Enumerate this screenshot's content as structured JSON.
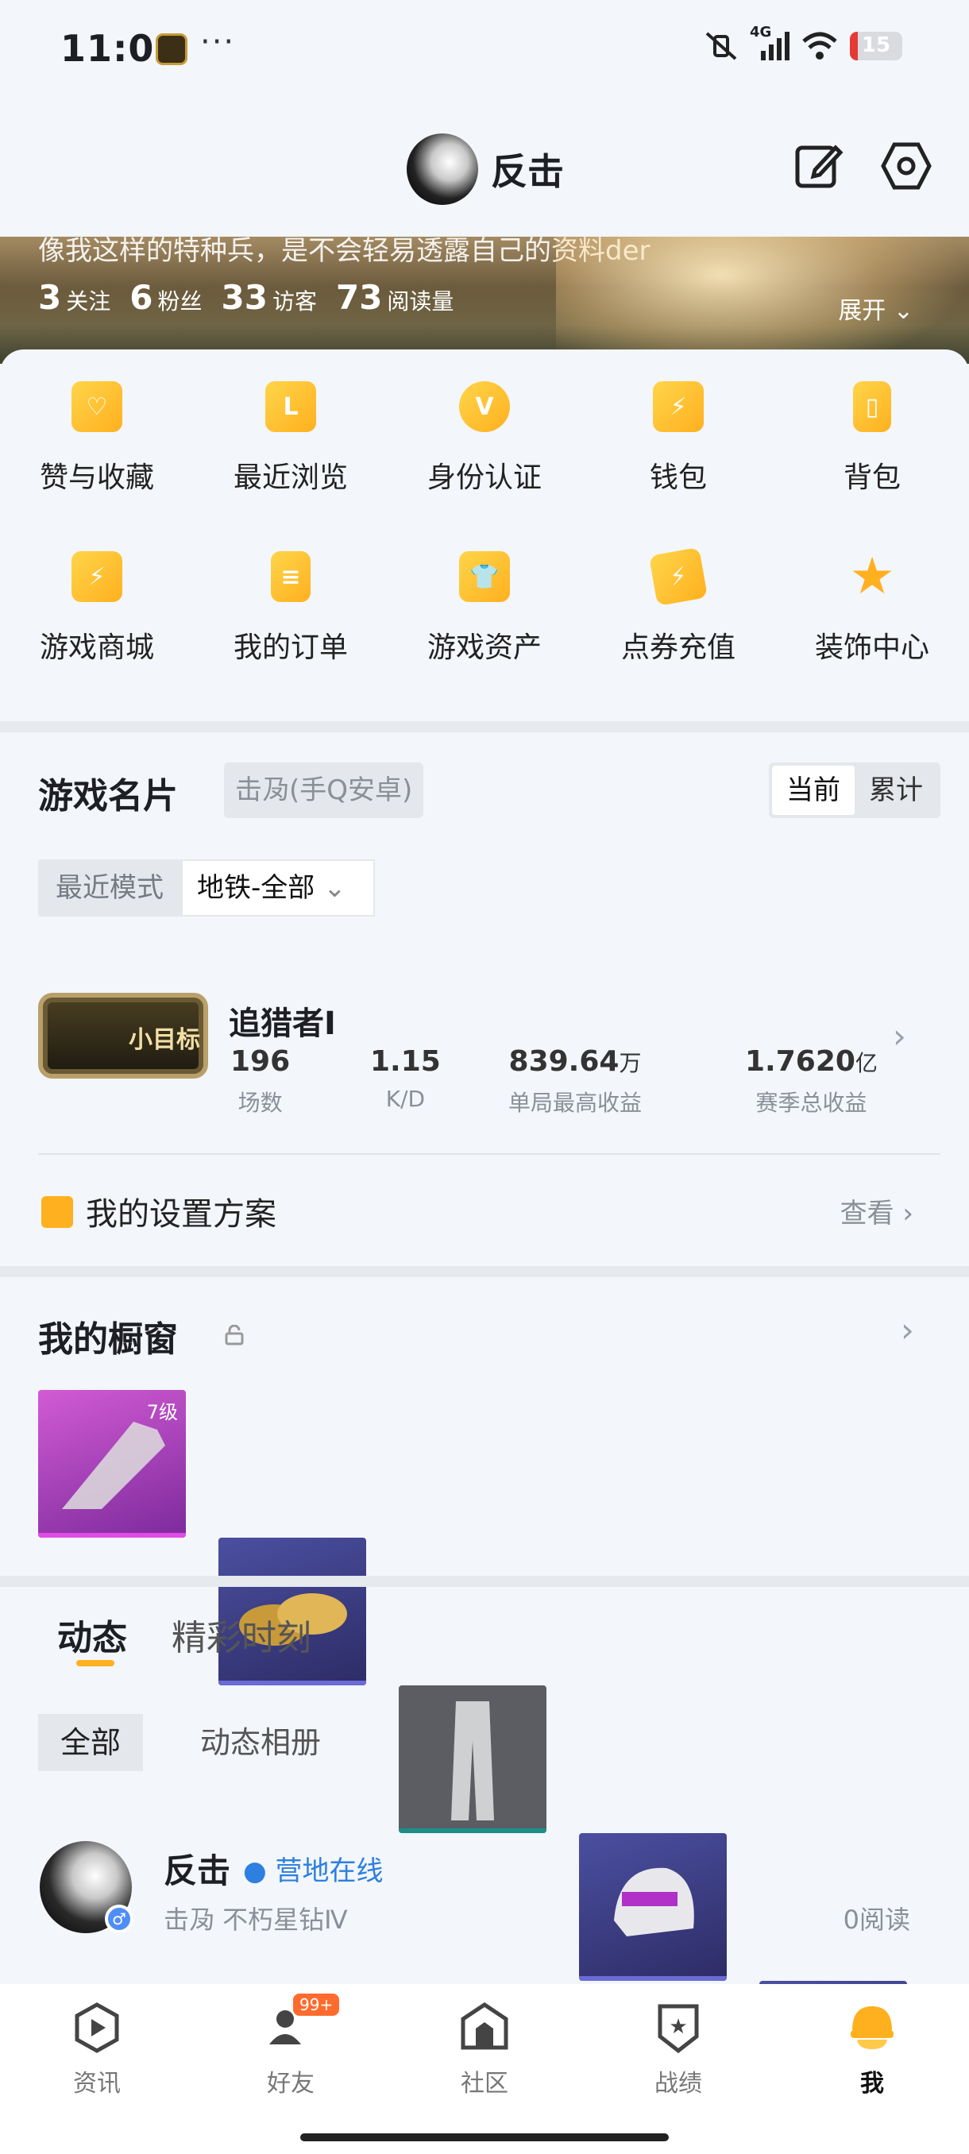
{
  "status_bar": {
    "time": "11:06",
    "dots": "···",
    "network": "4G",
    "battery": "15",
    "battery_pct": 0.15
  },
  "header": {
    "title": "反击"
  },
  "banner": {
    "text": "像我这样的特种兵，是不会轻易透露自己的资料der",
    "stats": [
      {
        "value": "3",
        "label": "关注"
      },
      {
        "value": "6",
        "label": "粉丝"
      },
      {
        "value": "33",
        "label": "访客"
      },
      {
        "value": "73",
        "label": "阅读量"
      }
    ],
    "expand": "展开"
  },
  "grid": [
    {
      "label": "赞与收藏",
      "icon": "heart-card-icon"
    },
    {
      "label": "最近浏览",
      "icon": "history-icon"
    },
    {
      "label": "身份认证",
      "icon": "v-badge-icon"
    },
    {
      "label": "钱包",
      "icon": "wallet-icon"
    },
    {
      "label": "背包",
      "icon": "backpack-icon"
    },
    {
      "label": "游戏商城",
      "icon": "shopping-bag-icon"
    },
    {
      "label": "我的订单",
      "icon": "order-icon"
    },
    {
      "label": "游戏资产",
      "icon": "tshirt-icon"
    },
    {
      "label": "点券充值",
      "icon": "coupon-icon"
    },
    {
      "label": "装饰中心",
      "icon": "star-icon"
    }
  ],
  "game_card": {
    "title": "游戏名片",
    "server": "击夃(手Q安卓)",
    "seg": [
      "当前",
      "累计"
    ],
    "mode_label": "最近模式",
    "mode_value": "地铁-全部",
    "badge_text": "小目标",
    "rank": "追猎者Ⅰ",
    "stats": [
      {
        "value": "196",
        "unit": "",
        "label": "场数"
      },
      {
        "value": "1.15",
        "unit": "",
        "label": "K/D"
      },
      {
        "value": "839.64",
        "unit": "万",
        "label": "单局最高收益"
      },
      {
        "value": "1.7620",
        "unit": "亿",
        "label": "赛季总收益"
      }
    ],
    "plan": "我的设置方案",
    "view": "查看"
  },
  "showcase": {
    "title": "我的橱窗",
    "items": [
      {
        "name": "weapon",
        "level": "7级",
        "color": "#b03ac4"
      },
      {
        "name": "shoes",
        "level": "",
        "color": "#3d3e86"
      },
      {
        "name": "pants",
        "level": "",
        "color": "#5a5c63"
      },
      {
        "name": "helmet",
        "level": "",
        "color": "#3d3e86"
      },
      {
        "name": "backpack",
        "level": "",
        "color": "#3d3e86"
      }
    ]
  },
  "feed": {
    "tabs": [
      "动态",
      "精彩时刻"
    ],
    "chips": [
      "全部",
      "动态相册"
    ],
    "post": {
      "name": "反击",
      "online": "营地在线",
      "sub": "击夃   不朽星钻Ⅳ",
      "reads": "0阅读"
    }
  },
  "nav": [
    {
      "label": "资讯",
      "icon": "news-icon"
    },
    {
      "label": "好友",
      "icon": "friends-icon",
      "badge": "99+"
    },
    {
      "label": "社区",
      "icon": "community-icon"
    },
    {
      "label": "战绩",
      "icon": "record-icon"
    },
    {
      "label": "我",
      "icon": "me-icon"
    }
  ],
  "colors": {
    "accent": "#ffb01f",
    "link": "#2d7fe0",
    "bg": "#f3f6fa"
  }
}
